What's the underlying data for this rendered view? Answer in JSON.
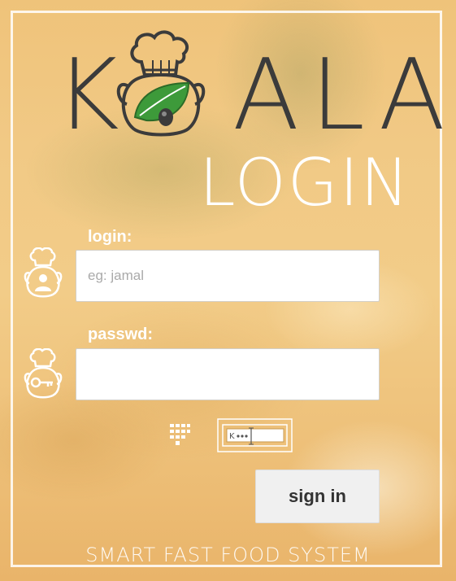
{
  "brand": {
    "logo_letter_left": "K",
    "logo_letters_right": "ALA",
    "title": "LOGIN"
  },
  "form": {
    "login_label": "login:",
    "login_placeholder": "eg: jamal",
    "login_value": "",
    "password_label": "passwd:",
    "password_value": "",
    "submit_label": "sign in"
  },
  "footer": {
    "text": "SMART FAST FOOD SYSTEM"
  },
  "icons": {
    "login": "koala-chef-user-icon",
    "password": "koala-chef-key-icon",
    "keypad": "keypad-icon",
    "virtual_keyboard": "virtual-keyboard-icon"
  },
  "colors": {
    "logo_text": "#3b3b3b",
    "leaf": "#3d9a3a",
    "button_bg": "#f0f0f0",
    "button_text": "#333333"
  }
}
